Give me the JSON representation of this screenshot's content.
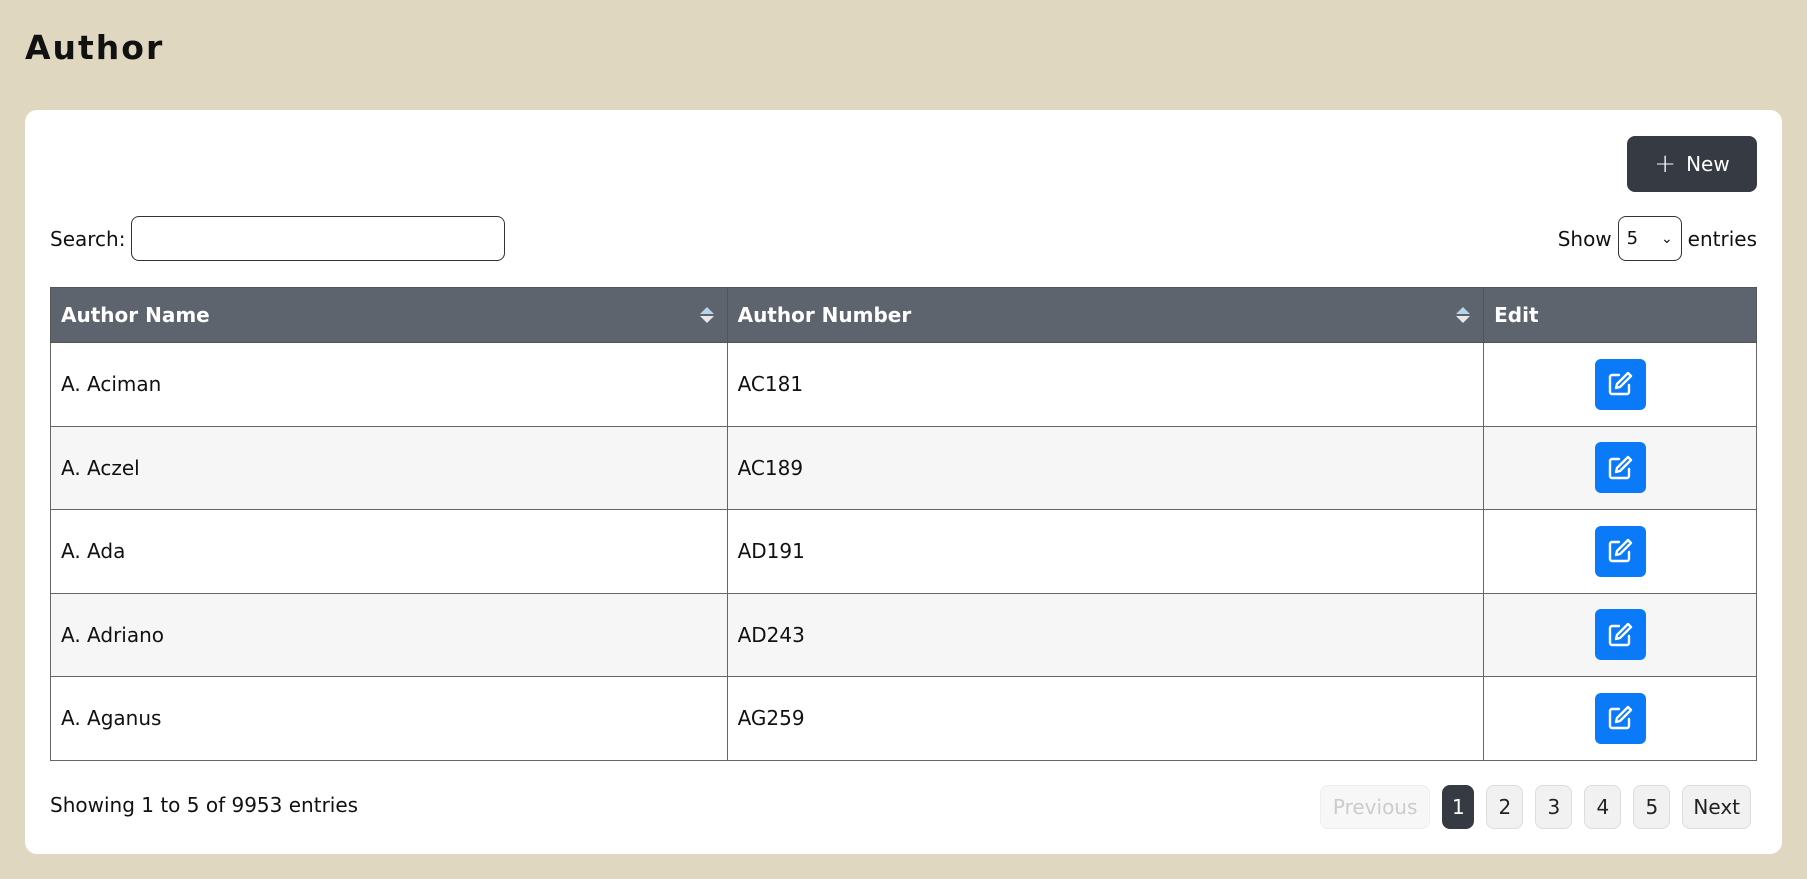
{
  "page": {
    "title": "Author"
  },
  "toolbar": {
    "new_label": "New"
  },
  "search": {
    "label": "Search:",
    "value": "",
    "placeholder": ""
  },
  "length": {
    "show_label": "Show",
    "selected": "5",
    "entries_label": "entries"
  },
  "table": {
    "headers": [
      "Author Name",
      "Author Number",
      "Edit"
    ],
    "rows": [
      {
        "name": "A. Aciman",
        "number": "AC181"
      },
      {
        "name": "A. Aczel",
        "number": "AC189"
      },
      {
        "name": "A. Ada",
        "number": "AD191"
      },
      {
        "name": "A. Adriano",
        "number": "AD243"
      },
      {
        "name": "A. Aganus",
        "number": "AG259"
      }
    ]
  },
  "footer": {
    "info": "Showing 1 to 5 of 9953 entries"
  },
  "pagination": {
    "previous": "Previous",
    "pages": [
      "1",
      "2",
      "3",
      "4",
      "5"
    ],
    "current": "1",
    "next": "Next"
  },
  "colors": {
    "background": "#dfd7c0",
    "header": "#5e646d",
    "dark_button": "#363a42",
    "edit_button": "#0a7af8"
  },
  "icons": {
    "new": "plus-icon",
    "edit": "edit-icon",
    "sort": "sort-icon",
    "select": "chevron-down-icon"
  }
}
